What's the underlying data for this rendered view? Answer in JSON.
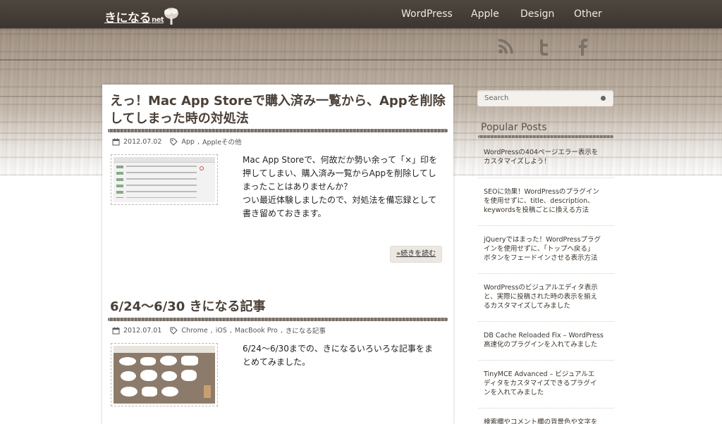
{
  "site": {
    "logo_text": "きになる",
    "logo_suffix": "net"
  },
  "nav": {
    "items": [
      "WordPress",
      "Apple",
      "Design",
      "Other"
    ]
  },
  "social": {
    "icons": [
      "rss-icon",
      "twitter-icon",
      "facebook-icon"
    ]
  },
  "posts": [
    {
      "title": "えっ！Mac App Storeで購入済み一覧から、Appを削除してしまった時の対処法",
      "date": "2012.07.02",
      "tags": [
        "App",
        "Appleその他"
      ],
      "excerpt_lines": [
        "Mac App Storeで、何故だか勢い余って「×」印を",
        "押してしまい、購入済み一覧からAppを削除してし",
        "まったことはありませんか？",
        "つい最近体験しましたので、対処法を備忘録として",
        "書き留めておきます。"
      ],
      "more_label": "»続きを読む"
    },
    {
      "title": "6/24〜6/30 きになる記事",
      "date": "2012.07.01",
      "tags": [
        "Chrome",
        "iOS",
        "MacBook Pro",
        "きになる記事"
      ],
      "excerpt_lines": [
        "6/24〜6/30までの、きになるいろいろな記事をま",
        "とめてみました。"
      ]
    }
  ],
  "sidebar": {
    "search_placeholder": "Search",
    "popular_title": "Popular Posts",
    "popular": [
      [
        "WordPressの404ページエラー表示を",
        "カスタマイズしよう！"
      ],
      [
        "SEOに効果！WordPressのプラグイン",
        "を使用せずに、title、description、",
        "keywordsを投稿ごとに換える方法"
      ],
      [
        "jQueryではまった！WordPressプラグ",
        "インを使用せずに、「トップへ戻る」",
        "ボタンをフェードインさせる表示方法"
      ],
      [
        "WordPressのビジュアルエディタ表示",
        "と、実際に投稿された時の表示を揃え",
        "るカスタマイズしてみました"
      ],
      [
        "DB Cache Reloaded Fix – WordPress",
        "高速化のプラグインを入れてみました"
      ],
      [
        "TinyMCE Advanced – ビジュアルエ",
        "ディタをカスタマイズできるプラグイ",
        "ンを入れてみました"
      ],
      [
        "検索欄やコメント欄の背景色や文字を"
      ]
    ]
  },
  "colors": {
    "topbar": "#3d3630",
    "title": "#4a4038",
    "accent_rule": "#6d625a"
  }
}
